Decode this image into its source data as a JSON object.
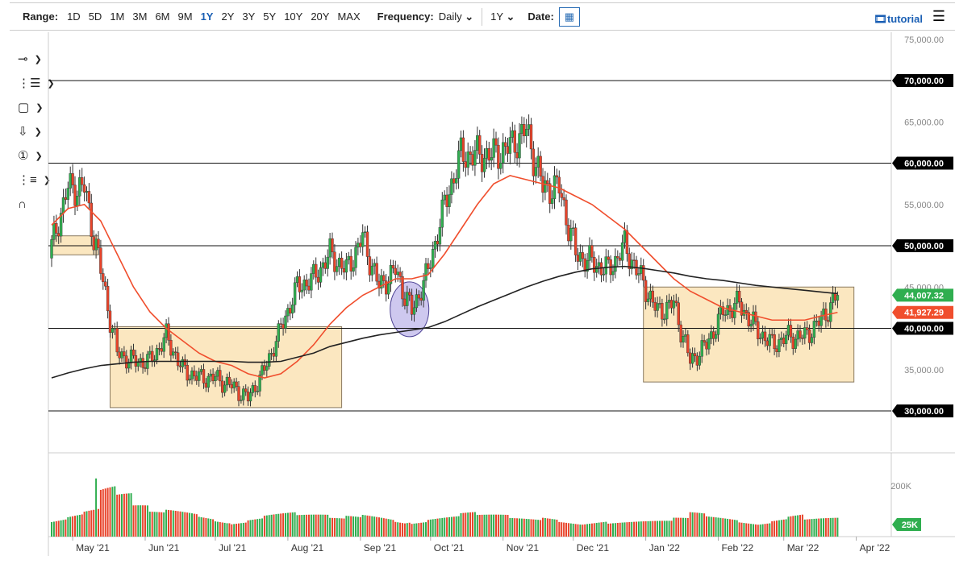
{
  "toolbar": {
    "range_label": "Range:",
    "ranges": [
      "1D",
      "5D",
      "1M",
      "3M",
      "6M",
      "9M",
      "1Y",
      "2Y",
      "3Y",
      "5Y",
      "10Y",
      "20Y",
      "MAX"
    ],
    "active_range": "1Y",
    "frequency_label": "Frequency:",
    "frequency": "Daily",
    "period": "1Y",
    "date_label": "Date:",
    "tutorial": "tutorial"
  },
  "drawing_tools": [
    "line-tool",
    "fib-tool",
    "rectangle-tool",
    "arrow-tool",
    "annotation-tool",
    "pattern-tool",
    "magnet-tool"
  ],
  "chart_data": {
    "type": "candlestick",
    "start_date": "2021-04-22",
    "interval_days": 7,
    "weekly_closes": [
      50000,
      57000,
      57000,
      47000,
      37000,
      36000,
      36000,
      39000,
      35000,
      34000,
      34000,
      33000,
      31500,
      35000,
      40000,
      45000,
      46000,
      49000,
      47000,
      51000,
      45000,
      47000,
      42000,
      47000,
      55000,
      61000,
      61000,
      61000,
      62000,
      64000,
      57000,
      57000,
      49000,
      48000,
      47000,
      50000,
      46000,
      42000,
      43000,
      36000,
      38000,
      42000,
      43000,
      40000,
      38000,
      39000,
      39000,
      41000,
      44000
    ],
    "ma50": [
      52500,
      54500,
      55000,
      53000,
      49000,
      45000,
      42000,
      40000,
      38500,
      37000,
      36000,
      35500,
      34500,
      34000,
      34500,
      36000,
      38000,
      40500,
      42500,
      44000,
      45000,
      46000,
      46000,
      46500,
      49000,
      52000,
      55000,
      57500,
      58500,
      58000,
      57500,
      57000,
      56000,
      55000,
      53500,
      52000,
      50000,
      48000,
      46000,
      44500,
      43500,
      42500,
      42000,
      41500,
      41000,
      41000,
      41000,
      41500,
      41927
    ],
    "ma200": [
      34000,
      34600,
      35100,
      35500,
      35700,
      35900,
      36000,
      36000,
      36000,
      36000,
      36000,
      36000,
      35900,
      35900,
      36000,
      36500,
      37000,
      37800,
      38300,
      38800,
      39200,
      39500,
      39800,
      40100,
      40800,
      41700,
      42600,
      43400,
      44200,
      45000,
      45700,
      46300,
      46800,
      47200,
      47400,
      47500,
      47300,
      47000,
      46700,
      46300,
      46000,
      45800,
      45500,
      45200,
      45000,
      44800,
      44600,
      44400,
      44200
    ],
    "volume_k": [
      60,
      70,
      80,
      150,
      120,
      80,
      60,
      70,
      70,
      60,
      50,
      40,
      50,
      60,
      60,
      50,
      50,
      40,
      50,
      60,
      60,
      50,
      40,
      50,
      50,
      60,
      50,
      50,
      40,
      40,
      50,
      40,
      40,
      40,
      30,
      30,
      30,
      30,
      40,
      60,
      50,
      50,
      40,
      40,
      50,
      60,
      40,
      40,
      30
    ],
    "price_ticks": [
      "75,000.00",
      "70,000.00",
      "65,000.00",
      "60,000.00",
      "55,000.00",
      "50,000.00",
      "45,000.00",
      "40,000.00",
      "35,000.00",
      "30,000.00"
    ],
    "highlighted_levels": [
      "70,000.00",
      "60,000.00",
      "50,000.00",
      "40,000.00",
      "30,000.00"
    ],
    "last_price": "44,007.32",
    "ma50_value": "41,927.29",
    "volume_ticks": [
      "200K"
    ],
    "volume_last": "25K",
    "x_ticks": [
      "May '21",
      "Jun '21",
      "Jul '21",
      "Aug '21",
      "Sep '21",
      "Oct '21",
      "Nov '21",
      "Dec '21",
      "Jan '22",
      "Feb '22",
      "Mar '22",
      "Apr '22"
    ],
    "colors": {
      "up": "#2fae4f",
      "down": "#e8432a",
      "ma50": "#f04e2d",
      "ma200": "#222222",
      "box": "#fbe7c0",
      "circle": "#c9c3ee"
    }
  }
}
